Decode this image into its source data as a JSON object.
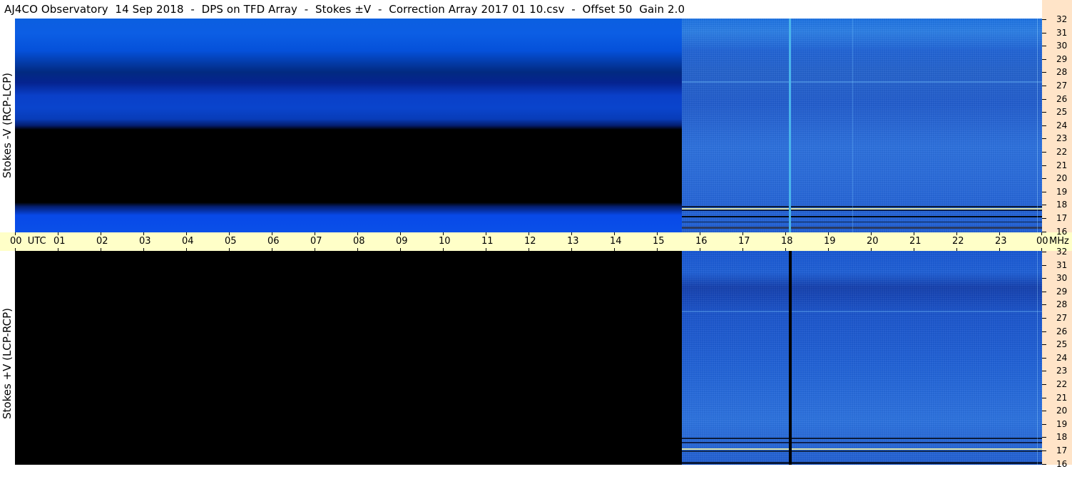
{
  "title": "AJ4CO Observatory  14 Sep 2018  -  DPS on TFD Array  -  Stokes ±V  -  Correction Array 2017 01 10.csv  -  Offset 50  Gain 2.0",
  "panels": {
    "top_label": "Stokes -V (RCP-LCP)",
    "bottom_label": "Stokes +V (LCP-RCP)"
  },
  "time_axis": {
    "labels": [
      "00  UTC",
      "01",
      "02",
      "03",
      "04",
      "05",
      "06",
      "07",
      "08",
      "09",
      "10",
      "11",
      "12",
      "13",
      "14",
      "15",
      "16",
      "17",
      "18",
      "19",
      "20",
      "21",
      "22",
      "23",
      "00"
    ],
    "unit": "MHz"
  },
  "freq_axis": {
    "labels": [
      "32",
      "31",
      "30",
      "29",
      "28",
      "27",
      "26",
      "25",
      "24",
      "23",
      "22",
      "21",
      "20",
      "19",
      "18",
      "17",
      "16"
    ]
  },
  "colors": {
    "time_axis_bg": "#ffffc8",
    "freq_axis_bg": "#ffe4c8",
    "spectrogram_blue": "#1e62da",
    "no_data": "#000000"
  }
}
